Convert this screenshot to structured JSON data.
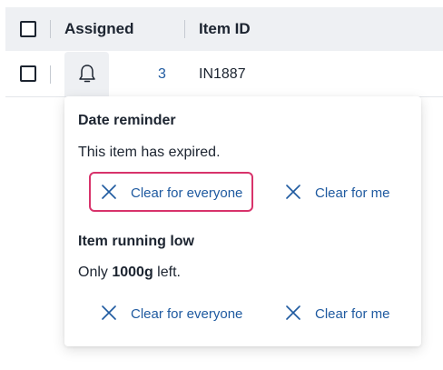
{
  "table": {
    "headers": {
      "assigned": "Assigned",
      "item_id": "Item ID"
    },
    "row": {
      "count": "3",
      "item_id": "IN1887"
    }
  },
  "popover": {
    "sections": [
      {
        "title": "Date reminder",
        "text": "This item has expired.",
        "clear_everyone": "Clear for everyone",
        "clear_me": "Clear for me"
      },
      {
        "title": "Item running low",
        "text_prefix": "Only ",
        "text_bold": "1000g",
        "text_suffix": " left.",
        "clear_everyone": "Clear for everyone",
        "clear_me": "Clear for me"
      }
    ]
  },
  "colors": {
    "accent": "#1f5aa0",
    "focus_ring": "#d8336b",
    "header_bg": "#eef0f3"
  },
  "icons": {
    "bell": "bell-icon",
    "close": "close-icon"
  }
}
